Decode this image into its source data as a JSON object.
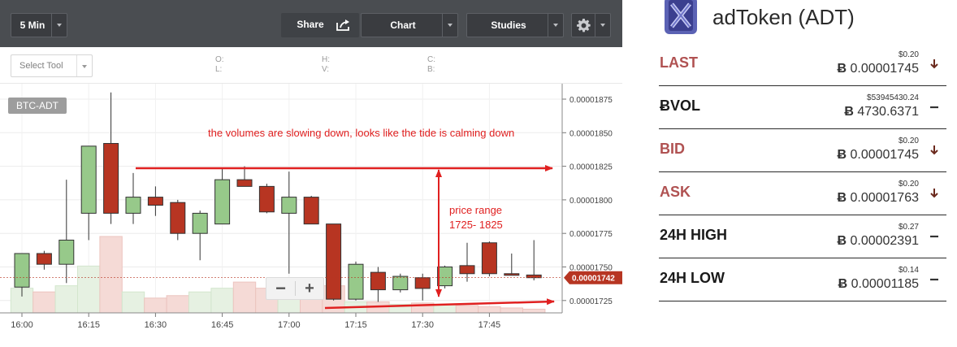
{
  "toolbar": {
    "interval": "5 Min",
    "share": "Share",
    "chart": "Chart",
    "studies": "Studies"
  },
  "tools": {
    "select_tool": "Select Tool",
    "ohlc": [
      "O:",
      "L:",
      "H:",
      "V:",
      "C:",
      "B:"
    ]
  },
  "chart_data": {
    "type": "candlestick",
    "symbol": "BTC-ADT",
    "x_labels": [
      "16:00",
      "16:15",
      "16:30",
      "16:45",
      "17:00",
      "17:15",
      "17:30",
      "17:45"
    ],
    "y_labels": [
      "0.00001875",
      "0.00001850",
      "0.00001825",
      "0.00001800",
      "0.00001775",
      "0.00001750",
      "0.00001725"
    ],
    "y_range": [
      1.72e-05,
      1.89e-05
    ],
    "interval_minutes": 5,
    "last_price_tag": "0.00001742",
    "candles": [
      {
        "time": "16:00",
        "open": 1.735e-05,
        "high": 1.76e-05,
        "low": 1.728e-05,
        "close": 1.76e-05
      },
      {
        "time": "16:05",
        "open": 1.76e-05,
        "high": 1.762e-05,
        "low": 1.748e-05,
        "close": 1.752e-05
      },
      {
        "time": "16:10",
        "open": 1.752e-05,
        "high": 1.815e-05,
        "low": 1.738e-05,
        "close": 1.77e-05
      },
      {
        "time": "16:15",
        "open": 1.79e-05,
        "high": 1.84e-05,
        "low": 1.77e-05,
        "close": 1.84e-05
      },
      {
        "time": "16:20",
        "open": 1.842e-05,
        "high": 1.88e-05,
        "low": 1.782e-05,
        "close": 1.79e-05
      },
      {
        "time": "16:25",
        "open": 1.79e-05,
        "high": 1.82e-05,
        "low": 1.782e-05,
        "close": 1.802e-05
      },
      {
        "time": "16:30",
        "open": 1.802e-05,
        "high": 1.81e-05,
        "low": 1.788e-05,
        "close": 1.796e-05
      },
      {
        "time": "16:35",
        "open": 1.798e-05,
        "high": 1.8e-05,
        "low": 1.77e-05,
        "close": 1.775e-05
      },
      {
        "time": "16:40",
        "open": 1.775e-05,
        "high": 1.792e-05,
        "low": 1.755e-05,
        "close": 1.79e-05
      },
      {
        "time": "16:45",
        "open": 1.782e-05,
        "high": 1.823e-05,
        "low": 1.782e-05,
        "close": 1.815e-05
      },
      {
        "time": "16:50",
        "open": 1.815e-05,
        "high": 1.825e-05,
        "low": 1.81e-05,
        "close": 1.81e-05
      },
      {
        "time": "16:55",
        "open": 1.81e-05,
        "high": 1.812e-05,
        "low": 1.79e-05,
        "close": 1.791e-05
      },
      {
        "time": "17:00",
        "open": 1.79e-05,
        "high": 1.821e-05,
        "low": 1.745e-05,
        "close": 1.802e-05
      },
      {
        "time": "17:05",
        "open": 1.802e-05,
        "high": 1.803e-05,
        "low": 1.782e-05,
        "close": 1.782e-05
      },
      {
        "time": "17:10",
        "open": 1.782e-05,
        "high": 1.782e-05,
        "low": 1.725e-05,
        "close": 1.726e-05
      },
      {
        "time": "17:15",
        "open": 1.726e-05,
        "high": 1.754e-05,
        "low": 1.725e-05,
        "close": 1.752e-05
      },
      {
        "time": "17:20",
        "open": 1.746e-05,
        "high": 1.75e-05,
        "low": 1.724e-05,
        "close": 1.733e-05
      },
      {
        "time": "17:25",
        "open": 1.733e-05,
        "high": 1.745e-05,
        "low": 1.731e-05,
        "close": 1.743e-05
      },
      {
        "time": "17:30",
        "open": 1.742e-05,
        "high": 1.745e-05,
        "low": 1.725e-05,
        "close": 1.734e-05
      },
      {
        "time": "17:35",
        "open": 1.736e-05,
        "high": 1.751e-05,
        "low": 1.734e-05,
        "close": 1.75e-05
      },
      {
        "time": "17:40",
        "open": 1.751e-05,
        "high": 1.768e-05,
        "low": 1.739e-05,
        "close": 1.745e-05
      },
      {
        "time": "17:45",
        "open": 1.768e-05,
        "high": 1.769e-05,
        "low": 1.743e-05,
        "close": 1.745e-05
      },
      {
        "time": "17:50",
        "open": 1.745e-05,
        "high": 1.76e-05,
        "low": 1.744e-05,
        "close": 1.744e-05
      },
      {
        "time": "17:55",
        "open": 1.744e-05,
        "high": 1.77e-05,
        "low": 1.74e-05,
        "close": 1.742e-05
      }
    ],
    "volume_bars": [
      0.2,
      0.17,
      0.22,
      0.38,
      0.62,
      0.17,
      0.12,
      0.14,
      0.17,
      0.2,
      0.25,
      0.2,
      0.17,
      0.14,
      0.22,
      0.09,
      0.09,
      0.07,
      0.08,
      0.07,
      0.06,
      0.05,
      0.04,
      0.03
    ],
    "annotations": {
      "note": "the volumes are slowing down, looks like the tide is calming down",
      "range_label": [
        "price range",
        "1725- 1825"
      ]
    }
  },
  "zoom": {
    "minus": "−",
    "plus": "+"
  },
  "coin": {
    "name": "adToken (ADT)"
  },
  "stats": [
    {
      "label": "LAST",
      "usd": "$0.20",
      "btc": "0.00001745",
      "trend": "down"
    },
    {
      "label": "VOL",
      "usd": "$53945430.24",
      "btc": "4730.6371",
      "trend": "flat"
    },
    {
      "label": "BID",
      "usd": "$0.20",
      "btc": "0.00001745",
      "trend": "down"
    },
    {
      "label": "ASK",
      "usd": "$0.20",
      "btc": "0.00001763",
      "trend": "down"
    },
    {
      "label": "24H HIGH",
      "usd": "$0.27",
      "btc": "0.00002391",
      "trend": "flat"
    },
    {
      "label": "24H LOW",
      "usd": "$0.14",
      "btc": "0.00001185",
      "trend": "flat"
    }
  ],
  "btc_symbol": "Ƀ",
  "colors": {
    "up": "#97c98a",
    "down": "#b73522",
    "accent_red": "#b05252",
    "annotation": "#e02020",
    "toolbar": "#4a4d51"
  }
}
